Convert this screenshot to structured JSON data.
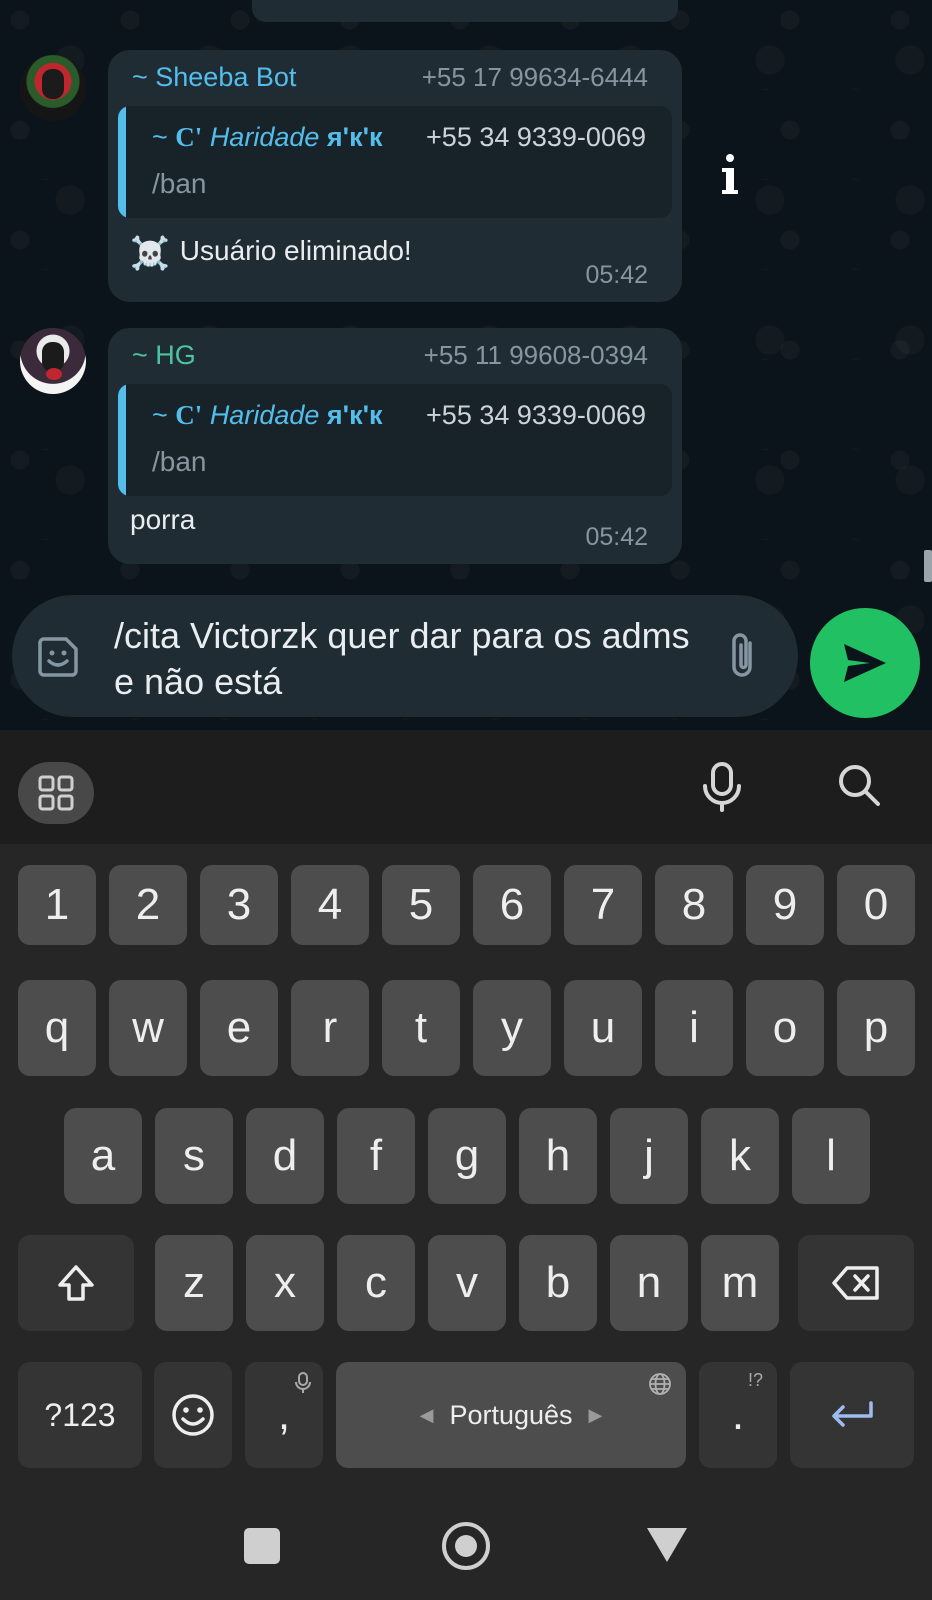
{
  "chat": {
    "messages": [
      {
        "sender": "~ Sheeba Bot",
        "phone": "+55 17 99634-6444",
        "quote": {
          "sender_c": "C'",
          "sender_name": "Haridade",
          "sender_suffix": "я'к'к",
          "sender_prefix": "~",
          "phone": "+55 34 9339-0069",
          "text": "/ban"
        },
        "emoji": "☠️",
        "text": "Usuário eliminado!",
        "time": "05:42"
      },
      {
        "sender": "~ HG",
        "phone": "+55 11 99608-0394",
        "quote": {
          "sender_c": "C'",
          "sender_name": "Haridade",
          "sender_suffix": "я'к'к",
          "sender_prefix": "~",
          "phone": "+55 34 9339-0069",
          "text": "/ban"
        },
        "text": "porra",
        "time": "05:42"
      }
    ]
  },
  "composer": {
    "text": "/cita Victorzk quer dar para os adms e não está"
  },
  "keyboard": {
    "row_numbers": [
      "1",
      "2",
      "3",
      "4",
      "5",
      "6",
      "7",
      "8",
      "9",
      "0"
    ],
    "row_top": [
      "q",
      "w",
      "e",
      "r",
      "t",
      "y",
      "u",
      "i",
      "o",
      "p"
    ],
    "row_middle": [
      "a",
      "s",
      "d",
      "f",
      "g",
      "h",
      "j",
      "k",
      "l"
    ],
    "row_bottom": [
      "z",
      "x",
      "c",
      "v",
      "b",
      "n",
      "m"
    ],
    "symbols_label": "?123",
    "comma": ",",
    "period": ".",
    "period_hint": "!?",
    "space_label": "Português",
    "left_arrow": "◀",
    "right_arrow": "▶"
  },
  "icons": {
    "sticker": "sticker-icon",
    "attach": "paperclip-icon",
    "send": "send-icon",
    "grid": "apps-grid-icon",
    "mic": "microphone-icon",
    "search": "search-icon",
    "shift": "shift-icon",
    "backspace": "backspace-icon",
    "emoji": "emoji-icon",
    "enter": "enter-icon",
    "globe": "globe-icon",
    "info": "info-icon"
  },
  "colors": {
    "accent_green": "#21c063",
    "link_blue": "#53bdeb",
    "teal_name": "#4fc3a1",
    "bubble": "#1f2c34",
    "background": "#0b141a"
  }
}
